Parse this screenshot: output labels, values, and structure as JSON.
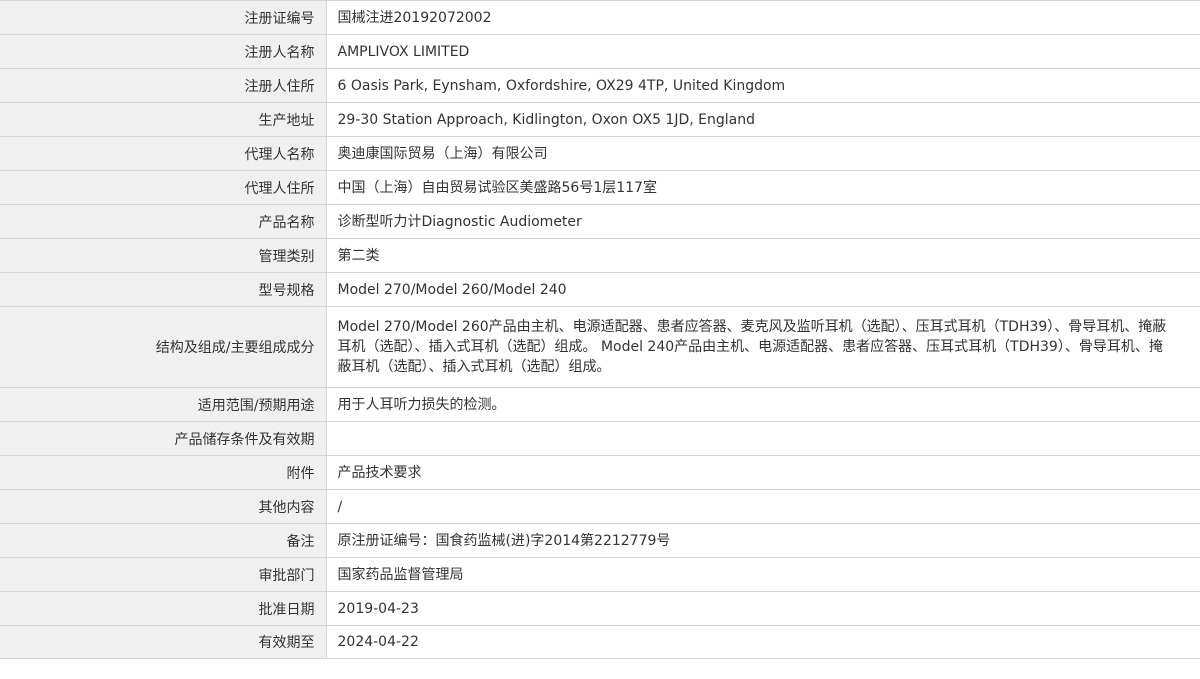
{
  "rows": [
    {
      "label": "注册证编号",
      "value": "国械注进20192072002"
    },
    {
      "label": "注册人名称",
      "value": "AMPLIVOX LIMITED"
    },
    {
      "label": "注册人住所",
      "value": "6 Oasis Park, Eynsham, Oxfordshire, OX29 4TP, United Kingdom"
    },
    {
      "label": "生产地址",
      "value": "29-30 Station Approach, Kidlington, Oxon OX5 1JD, England"
    },
    {
      "label": "代理人名称",
      "value": "奥迪康国际贸易（上海）有限公司"
    },
    {
      "label": "代理人住所",
      "value": "中国（上海）自由贸易试验区美盛路56号1层117室"
    },
    {
      "label": "产品名称",
      "value": "诊断型听力计Diagnostic Audiometer"
    },
    {
      "label": "管理类别",
      "value": "第二类"
    },
    {
      "label": "型号规格",
      "value": "Model 270/Model 260/Model 240"
    },
    {
      "label": "结构及组成/主要组成成分",
      "value": "Model 270/Model 260产品由主机、电源适配器、患者应答器、麦克风及监听耳机（选配）、压耳式耳机（TDH39）、骨导耳机、掩蔽耳机（选配）、插入式耳机（选配）组成。 Model 240产品由主机、电源适配器、患者应答器、压耳式耳机（TDH39）、骨导耳机、掩蔽耳机（选配）、插入式耳机（选配）组成。"
    },
    {
      "label": "适用范围/预期用途",
      "value": "用于人耳听力损失的检测。"
    },
    {
      "label": "产品储存条件及有效期",
      "value": ""
    },
    {
      "label": "附件",
      "value": "产品技术要求"
    },
    {
      "label": "其他内容",
      "value": "/"
    },
    {
      "label": "备注",
      "value": "原注册证编号：国食药监械(进)字2014第2212779号"
    },
    {
      "label": "审批部门",
      "value": "国家药品监督管理局"
    },
    {
      "label": "批准日期",
      "value": "2019-04-23"
    },
    {
      "label": "有效期至",
      "value": "2024-04-22"
    }
  ]
}
